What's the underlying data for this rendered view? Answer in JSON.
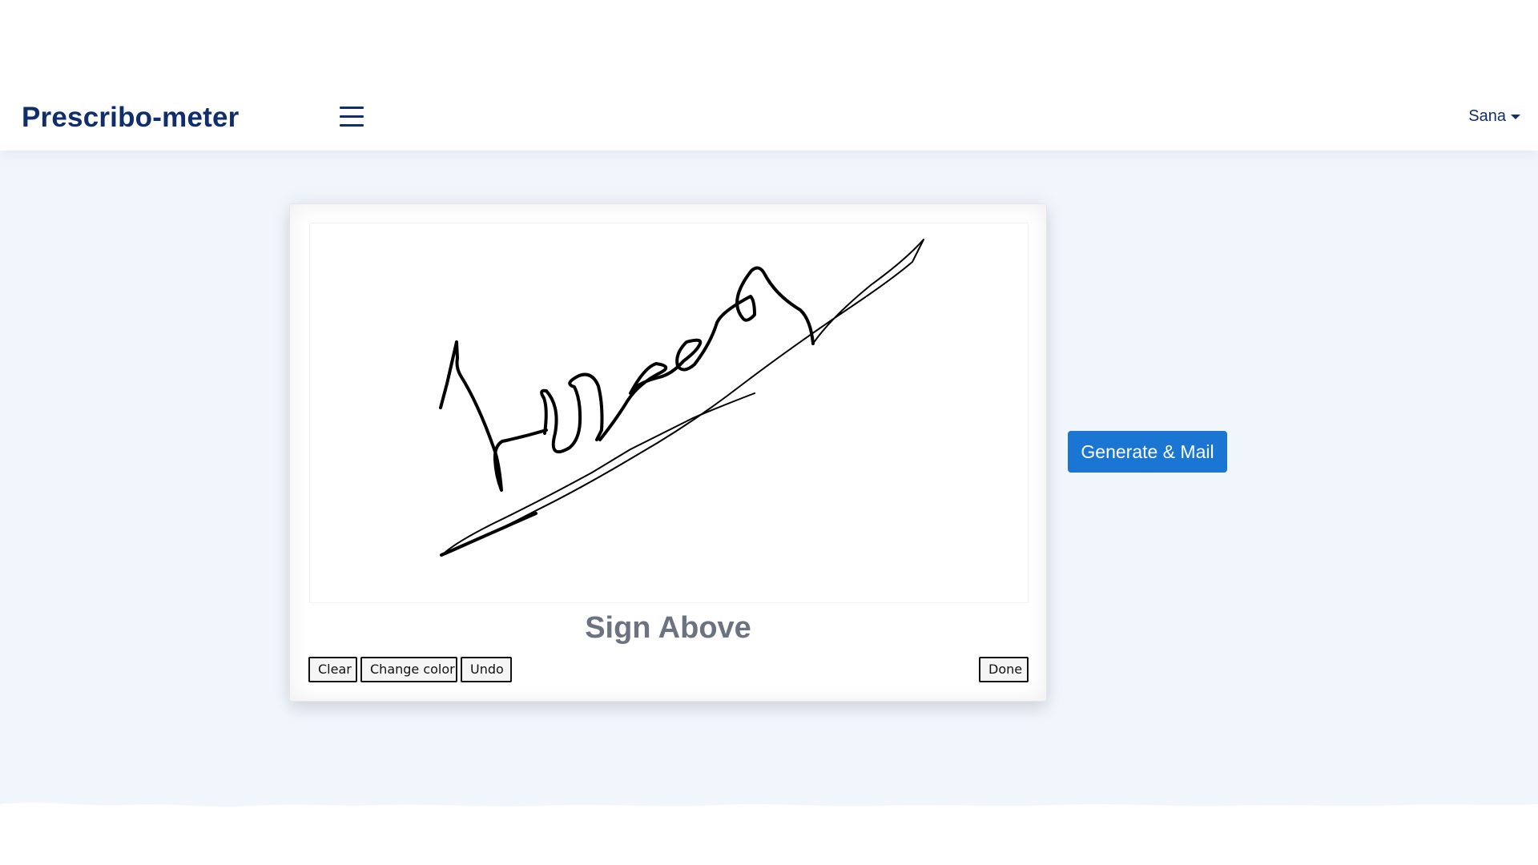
{
  "app": {
    "brand": "Prescribo-meter"
  },
  "header": {
    "menu_icon": "hamburger-menu-icon",
    "user_name": "Sana",
    "user_caret_icon": "caret-down-icon"
  },
  "signature_pad": {
    "label": "Sign Above",
    "buttons": {
      "clear": "Clear",
      "change_color": "Change color",
      "undo": "Undo",
      "done": "Done"
    },
    "ink_color": "#000000"
  },
  "actions": {
    "generate_mail": "Generate & Mail"
  },
  "colors": {
    "brand": "#0f2e6b",
    "primary_button": "#1a76d2",
    "page_background": "#f1f5fc"
  }
}
